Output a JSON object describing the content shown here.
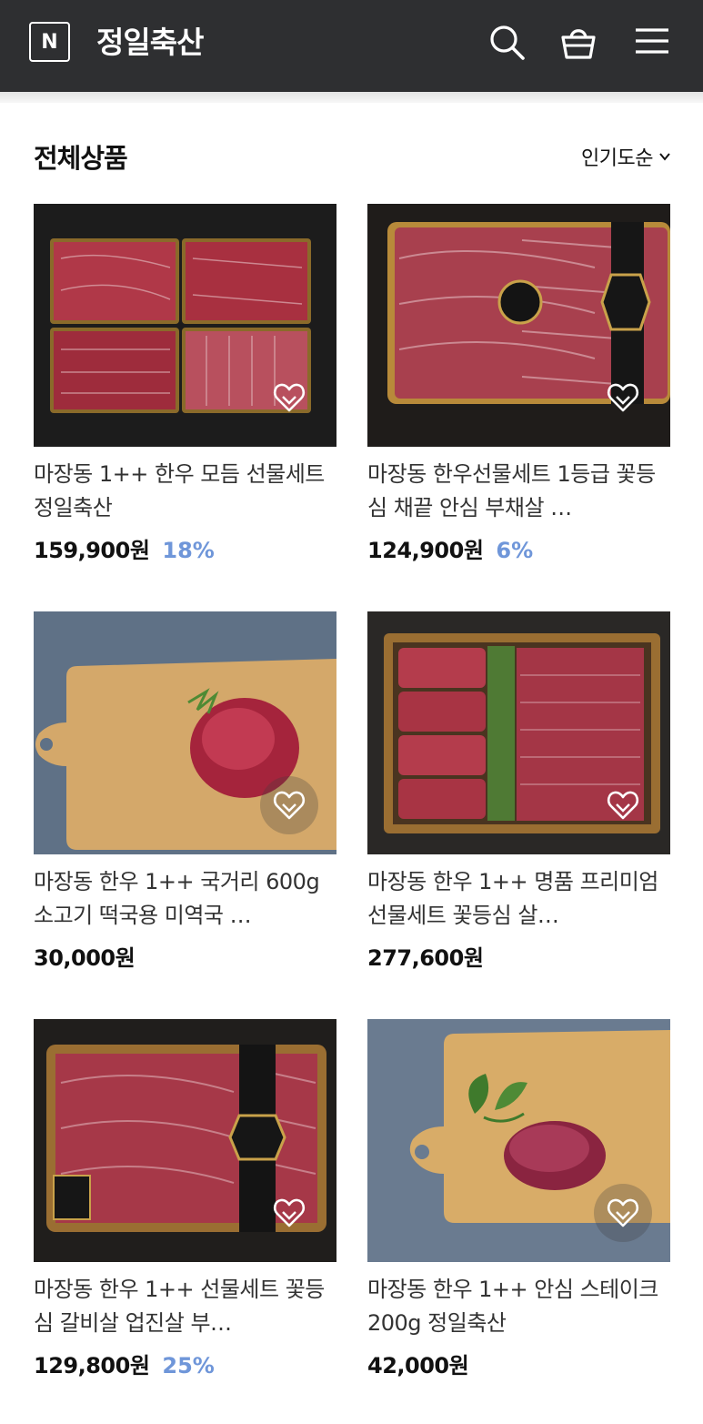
{
  "header": {
    "logo_letter": "N",
    "store_name": "정일축산",
    "background": "#2e2f31"
  },
  "section": {
    "title": "전체상품",
    "sort_label": "인기도순"
  },
  "colors": {
    "discount": "#6f96d9"
  },
  "products": [
    {
      "title": "마장동 1++ 한우 모듬 선물세트 정일축산",
      "price": "159,900원",
      "discount": "18%"
    },
    {
      "title": "마장동 한우선물세트 1등급 꽃등심 채끝 안심 부채살 …",
      "price": "124,900원",
      "discount": "6%"
    },
    {
      "title": "마장동 한우 1++ 국거리 600g 소고기 떡국용 미역국 …",
      "price": "30,000원",
      "discount": ""
    },
    {
      "title": "마장동 한우 1++ 명품 프리미엄 선물세트 꽃등심 살…",
      "price": "277,600원",
      "discount": ""
    },
    {
      "title": "마장동 한우 1++ 선물세트 꽃등심 갈비살 업진살 부…",
      "price": "129,800원",
      "discount": "25%"
    },
    {
      "title": "마장동 한우 1++ 안심 스테이크 200g 정일축산",
      "price": "42,000원",
      "discount": ""
    }
  ]
}
